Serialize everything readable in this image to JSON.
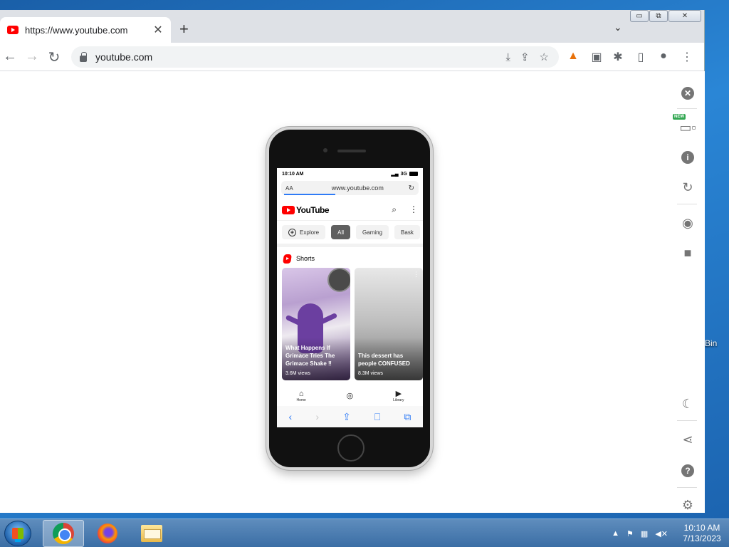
{
  "browser": {
    "tab": {
      "title": "https://www.youtube.com",
      "close": "✕"
    },
    "new_tab": "+",
    "tab_list": "⌄",
    "window_controls": {
      "minimize": "▭",
      "restore": "⧉",
      "close": "✕"
    },
    "nav": {
      "back": "←",
      "forward": "→",
      "reload": "↻"
    },
    "address": "youtube.com",
    "toolbar_icons": {
      "download": "⤓",
      "share": "⇪",
      "bookmark": "☆",
      "extensions": "✱",
      "sidepanel": "▯",
      "profile": "●",
      "menu": "⋮"
    }
  },
  "right_panel": {
    "new_badge": "NEW",
    "close": "✕",
    "info": "i",
    "help": "?"
  },
  "phone": {
    "status": {
      "time": "10:10 AM",
      "network": "3G"
    },
    "safari": {
      "aa": "AA",
      "url": "www.youtube.com",
      "reload": "↻"
    },
    "youtube": {
      "logo": "YouTube",
      "chips": [
        "Explore",
        "All",
        "Gaming",
        "Bask"
      ],
      "shorts_title": "Shorts",
      "shorts": [
        {
          "title": "What Happens If Grimace Tries The Grimace Shake ‼",
          "views": "3.6M views"
        },
        {
          "title": "This dessert has people CONFUSED",
          "views": "8.3M views"
        }
      ],
      "nav": {
        "home": "Home",
        "library": "Library"
      }
    }
  },
  "desktop": {
    "label": "Bin"
  },
  "taskbar": {
    "clock": {
      "time": "10:10 AM",
      "date": "7/13/2023"
    }
  }
}
